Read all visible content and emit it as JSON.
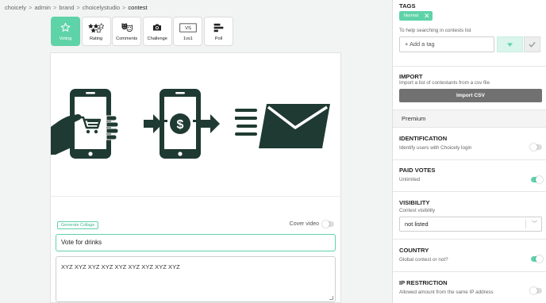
{
  "breadcrumb": [
    "choicely",
    "admin",
    "brand",
    "choicelystudio",
    "contest"
  ],
  "breadcrumb_separator": ">",
  "contest_types": [
    {
      "label": "Voting",
      "icon": "star-outline-icon",
      "active": true
    },
    {
      "label": "Rating",
      "icon": "stars-rating-icon",
      "active": false
    },
    {
      "label": "Comments",
      "icon": "theater-masks-icon",
      "active": false
    },
    {
      "label": "Challenge",
      "icon": "camera-icon",
      "active": false
    },
    {
      "label": "1vs1",
      "icon": "versus-icon",
      "active": false
    },
    {
      "label": "Poll",
      "icon": "poll-bars-icon",
      "active": false
    }
  ],
  "collage_button": "Generate Collage",
  "cover_video_label": "Cover video",
  "cover_video_on": false,
  "title_value": "Vote for drinks",
  "description_value": "XYZ XYZ XYZ XYZ XYZ XYZ XYZ XYZ XYZ",
  "sidebar": {
    "tags": {
      "title": "TAGS",
      "chip": "Normal",
      "help": "To help searching in contests list",
      "placeholder": "+ Add a tag"
    },
    "import": {
      "title": "IMPORT",
      "subtitle": "Import a list of contestants from a csv file",
      "button": "Import CSV"
    },
    "premium_label": "Premium",
    "identification": {
      "title": "IDENTIFICATION",
      "subtitle": "Identify users with Choicely login",
      "on": false
    },
    "paid_votes": {
      "title": "PAID VOTES",
      "subtitle": "Unlimited",
      "on": true
    },
    "visibility": {
      "title": "VISIBILITY",
      "subtitle": "Contest visibility",
      "selected": "not listed"
    },
    "country": {
      "title": "COUNTRY",
      "subtitle": "Global contest or not?",
      "on": true
    },
    "ip_restriction": {
      "title": "IP RESTRICTION",
      "subtitle": "Allowed amount from the same IP address",
      "on": false
    }
  },
  "colors": {
    "accent": "#5fd3a8",
    "hero_icon": "#1f3a32",
    "import_button": "#717171"
  }
}
